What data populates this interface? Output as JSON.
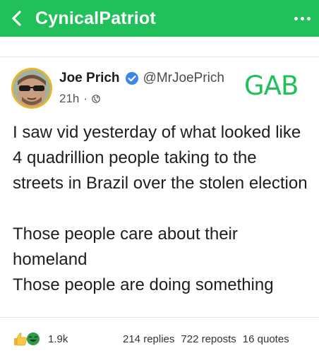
{
  "header": {
    "title": "CynicalPatriot",
    "back_icon": "chevron-left-icon",
    "more_icon": "more-dots-icon",
    "background_color": "#21c05b"
  },
  "post": {
    "author_name": "Joe Prich",
    "handle": "@MrJoePrich",
    "time": "21h",
    "separator": "·",
    "verified_icon": "verified-badge-icon",
    "visibility_icon": "globe-icon",
    "watermark": "GAB",
    "body": [
      "I saw vid yesterday of what looked like 4 quadrillion people taking to the streets in Brazil over the stolen election",
      "Those people care about their homeland",
      "Those people are doing something"
    ]
  },
  "stats": {
    "reaction_count": "1.9k",
    "replies": "214 replies",
    "reposts": "722 reposts",
    "quotes": "16 quotes"
  }
}
